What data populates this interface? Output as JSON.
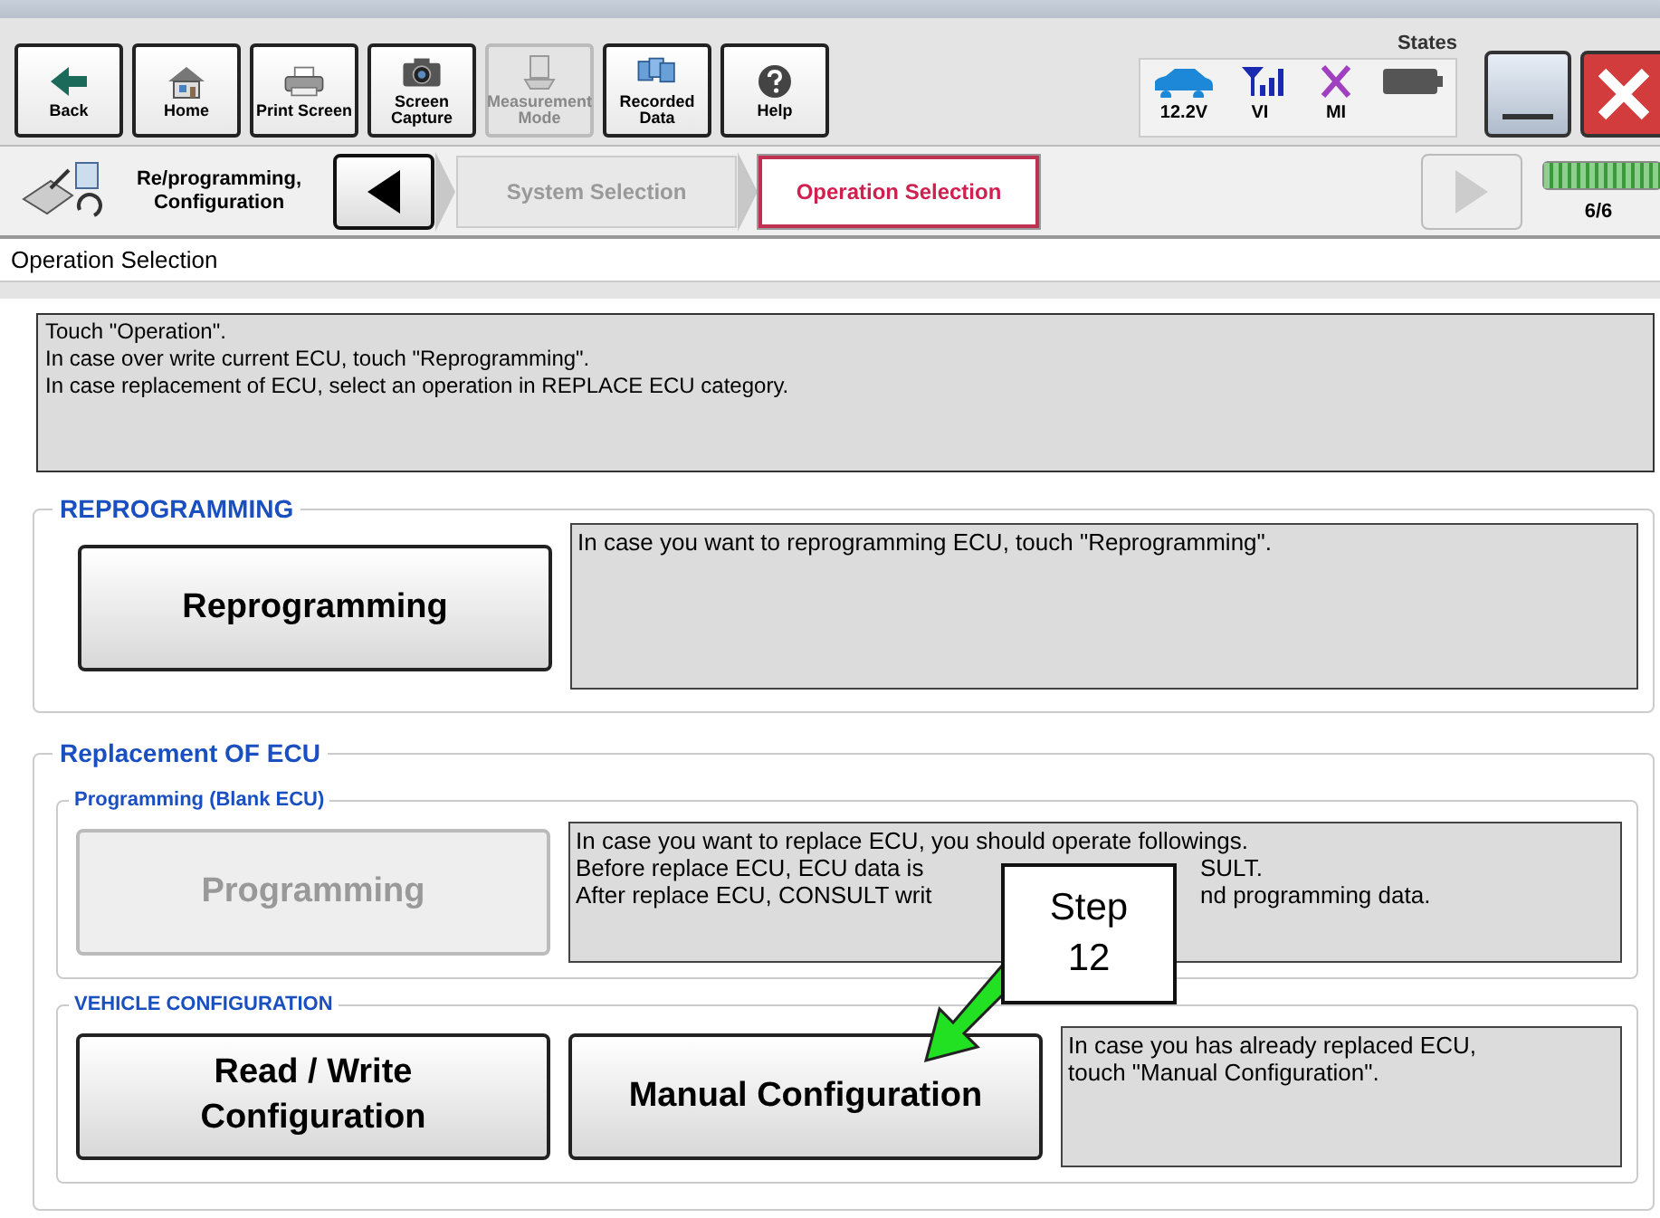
{
  "states_label": "States",
  "toolbar": [
    {
      "kind": "back",
      "label": "Back",
      "disabled": false
    },
    {
      "kind": "home",
      "label": "Home",
      "disabled": false
    },
    {
      "kind": "print",
      "label": "Print Screen",
      "disabled": false
    },
    {
      "kind": "camera",
      "label": "Screen Capture",
      "disabled": false
    },
    {
      "kind": "meter",
      "label": "Measurement Mode",
      "disabled": true
    },
    {
      "kind": "data",
      "label": "Recorded Data",
      "disabled": false
    },
    {
      "kind": "help",
      "label": "Help",
      "disabled": false
    }
  ],
  "status": [
    {
      "kind": "car",
      "label": "12.2V"
    },
    {
      "kind": "signal",
      "label": "VI"
    },
    {
      "kind": "cross",
      "label": "MI"
    },
    {
      "kind": "battery"
    }
  ],
  "breadcrumb": {
    "title": "Re/programming, Configuration",
    "steps": [
      {
        "label": "System Selection",
        "selected": false
      },
      {
        "label": "Operation Selection",
        "selected": true
      }
    ],
    "page": "6/6",
    "level": 1
  },
  "section_title": "Operation Selection",
  "instructions": [
    "Touch \"Operation\".",
    "In case over write current ECU, touch \"Reprogramming\".",
    "In case replacement of ECU, select an operation in REPLACE ECU category."
  ],
  "reprogramming": {
    "title": "REPROGRAMMING",
    "buttons": [
      {
        "label": "Reprogramming",
        "disabled": false
      }
    ],
    "description": [
      [
        "In case you want to reprogramming ECU, touch \"Reprogramming\"."
      ]
    ]
  },
  "replacement": {
    "title": "Replacement OF ECU",
    "subgroups": [
      {
        "title": "Programming (Blank ECU)",
        "buttons": [
          {
            "label": "Programming",
            "disabled": true
          }
        ],
        "description": [
          [
            "In case you want to replace ECU, you should operate followings."
          ],
          [
            "Before replace ECU, ECU data is",
            "SULT."
          ],
          [
            "After replace ECU, CONSULT writ",
            "nd programming data."
          ]
        ]
      },
      {
        "title": "VEHICLE CONFIGURATION",
        "buttons": [
          {
            "label": "Read / Write Configuration",
            "disabled": false
          },
          {
            "label": "Manual Configuration",
            "disabled": false
          }
        ],
        "description": [
          [
            "In case you has already replaced ECU,"
          ],
          [
            "touch \"Manual Configuration\"."
          ]
        ]
      }
    ]
  },
  "callout": {
    "label": "Step 12"
  }
}
